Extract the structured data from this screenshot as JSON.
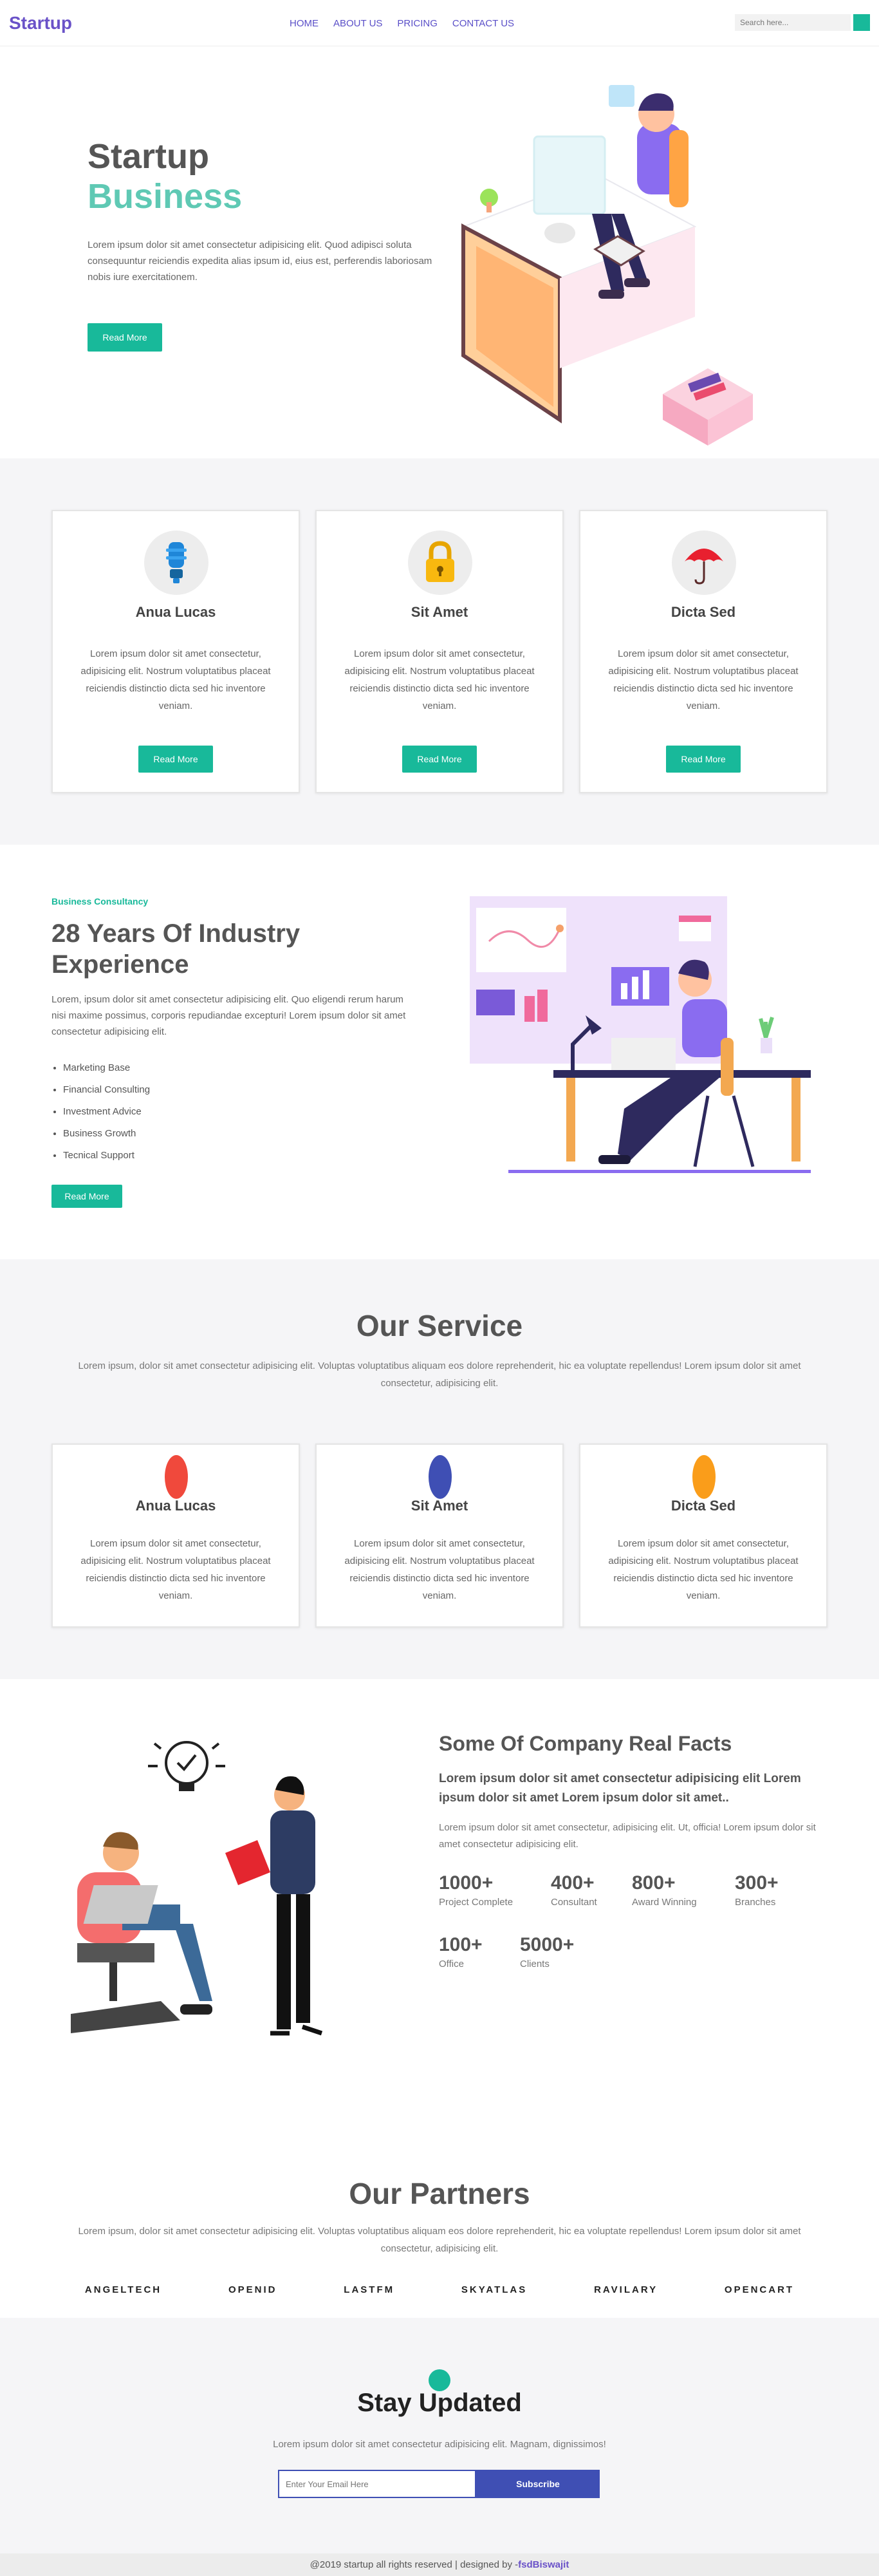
{
  "nav": {
    "brand": "Startup",
    "items": [
      "HOME",
      "ABOUT US",
      "PRICING",
      "CONTACT US"
    ],
    "search_placeholder": "Search here..."
  },
  "hero": {
    "title_line1": "Startup",
    "title_line2": "Business",
    "text": "Lorem ipsum dolor sit amet consectetur adipisicing elit. Quod adipisci soluta consequuntur reiciendis expedita alias ipsum id, eius est, perferendis laboriosam nobis iure exercitationem.",
    "button": "Read More"
  },
  "features": [
    {
      "title": "Anua Lucas",
      "icon": "lightbulb-icon",
      "text": "Lorem ipsum dolor sit amet consectetur, adipisicing elit. Nostrum voluptatibus placeat reiciendis distinctio dicta sed hic inventore veniam.",
      "button": "Read More"
    },
    {
      "title": "Sit Amet",
      "icon": "lock-icon",
      "text": "Lorem ipsum dolor sit amet consectetur, adipisicing elit. Nostrum voluptatibus placeat reiciendis distinctio dicta sed hic inventore veniam.",
      "button": "Read More"
    },
    {
      "title": "Dicta Sed",
      "icon": "umbrella-icon",
      "text": "Lorem ipsum dolor sit amet consectetur, adipisicing elit. Nostrum voluptatibus placeat reiciendis distinctio dicta sed hic inventore veniam.",
      "button": "Read More"
    }
  ],
  "about": {
    "tag": "Business Consultancy",
    "title": "28 Years Of Industry Experience",
    "text": "Lorem, ipsum dolor sit amet consectetur adipisicing elit. Quo eligendi rerum harum nisi maxime possimus, corporis repudiandae excepturi! Lorem ipsum dolor sit amet consectetur adipisicing elit.",
    "list": [
      "Marketing Base",
      "Financial Consulting",
      "Investment Advice",
      "Business Growth",
      "Tecnical Support"
    ],
    "button": "Read More"
  },
  "services": {
    "title": "Our Service",
    "subtitle": "Lorem ipsum, dolor sit amet consectetur adipisicing elit. Voluptas voluptatibus aliquam eos dolore reprehenderit, hic ea voluptate repellendus! Lorem ipsum dolor sit amet consectetur, adipisicing elit.",
    "cards": [
      {
        "title": "Anua Lucas",
        "color": "#f0493c",
        "text": "Lorem ipsum dolor sit amet consectetur, adipisicing elit. Nostrum voluptatibus placeat reiciendis distinctio dicta sed hic inventore veniam."
      },
      {
        "title": "Sit Amet",
        "color": "#3f4fb4",
        "text": "Lorem ipsum dolor sit amet consectetur, adipisicing elit. Nostrum voluptatibus placeat reiciendis distinctio dicta sed hic inventore veniam."
      },
      {
        "title": "Dicta Sed",
        "color": "#fa9d1a",
        "text": "Lorem ipsum dolor sit amet consectetur, adipisicing elit. Nostrum voluptatibus placeat reiciendis distinctio dicta sed hic inventore veniam."
      }
    ]
  },
  "facts": {
    "title": "Some Of Company Real Facts",
    "lead": "Lorem ipsum dolor sit amet consectetur adipisicing elit Lorem ipsum dolor sit amet Lorem ipsum dolor sit amet..",
    "text": "Lorem ipsum dolor sit amet consectetur, adipisicing elit. Ut, officia! Lorem ipsum dolor sit amet consectetur adipisicing elit.",
    "stats": [
      {
        "value": "1000+",
        "label": "Project Complete"
      },
      {
        "value": "400+",
        "label": "Consultant"
      },
      {
        "value": "800+",
        "label": "Award Winning"
      },
      {
        "value": "300+",
        "label": "Branches"
      },
      {
        "value": "100+",
        "label": "Office"
      },
      {
        "value": "5000+",
        "label": "Clients"
      }
    ]
  },
  "partners": {
    "title": "Our Partners",
    "subtitle": "Lorem ipsum, dolor sit amet consectetur adipisicing elit. Voluptas voluptatibus aliquam eos dolore reprehenderit, hic ea voluptate repellendus! Lorem ipsum dolor sit amet consectetur, adipisicing elit.",
    "logos": [
      "ANGELTECH",
      "OPENID",
      "LASTFM",
      "SKYATLAS",
      "RAVILARY",
      "OPENCART"
    ]
  },
  "subscribe": {
    "title": "Stay Updated",
    "text": "Lorem ipsum dolor sit amet consectetur adipisicing elit. Magnam, dignissimos!",
    "placeholder": "Enter Your Email Here",
    "button": "Subscribe"
  },
  "footer": {
    "text": "@2019 startup all rights reserved | designed by -",
    "author": "fsdBiswajit"
  }
}
